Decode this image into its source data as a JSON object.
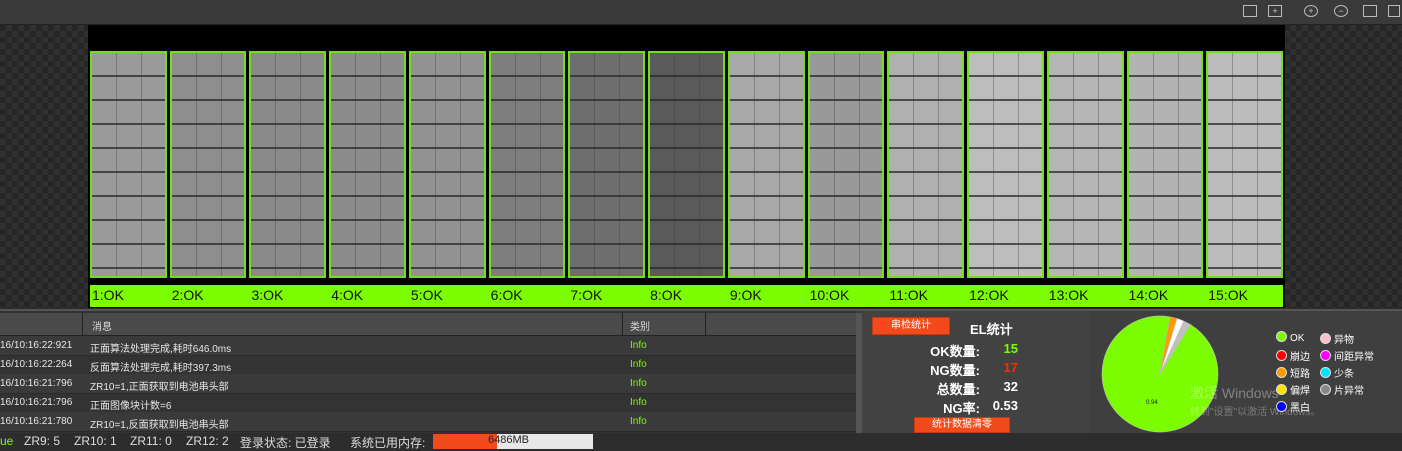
{
  "toolbar": {
    "icons": [
      "fit-icon",
      "crosshair-icon",
      "zoom-in-icon",
      "zoom-out-icon",
      "fullscreen-icon",
      "restore-icon"
    ]
  },
  "cells": [
    "1:OK",
    "2:OK",
    "3:OK",
    "4:OK",
    "5:OK",
    "6:OK",
    "7:OK",
    "8:OK",
    "9:OK",
    "10:OK",
    "11:OK",
    "12:OK",
    "13:OK",
    "14:OK",
    "15:OK"
  ],
  "log": {
    "headers": {
      "time": "",
      "message": "消息",
      "level": "类别"
    },
    "rows": [
      {
        "time": "16/10:16:22:921",
        "message": "正面算法处理完成,耗时646.0ms",
        "level": "Info"
      },
      {
        "time": "16/10:16:22:264",
        "message": "反面算法处理完成,耗时397.3ms",
        "level": "Info"
      },
      {
        "time": "16/10:16:21:796",
        "message": "ZR10=1,正面获取到电池串头部",
        "level": "Info"
      },
      {
        "time": "16/10:16:21:796",
        "message": "正面图像块计数=6",
        "level": "Info"
      },
      {
        "time": "16/10:16:21:780",
        "message": "ZR10=1,反面获取到电池串头部",
        "level": "Info"
      }
    ]
  },
  "stats": {
    "title": "EL统计",
    "top_button": "串检统计",
    "clear_button": "统计数据清零",
    "ok_label": "OK数量:",
    "ok_value": "15",
    "ng_label": "NG数量:",
    "ng_value": "17",
    "total_label": "总数量:",
    "total_value": "32",
    "rate_label": "NG率:",
    "rate_value": "0.53",
    "colors": {
      "ok": "#7cfc00",
      "ng": "#ff2a00"
    }
  },
  "pie": {
    "center_label": "0.94",
    "slices": [
      {
        "name": "OK",
        "fraction": 0.94,
        "color": "#7cfc00"
      },
      {
        "name": "短路",
        "fraction": 0.02,
        "color": "#ff9900"
      },
      {
        "name": "少条",
        "fraction": 0.02,
        "color": "#ffffff"
      },
      {
        "name": "片异常",
        "fraction": 0.02,
        "color": "#c0c0c0"
      }
    ]
  },
  "legend": [
    {
      "label": "OK",
      "color": "#7cfc00"
    },
    {
      "label": "异物",
      "color": "#ffc0cb"
    },
    {
      "label": "崩边",
      "color": "#ff0000"
    },
    {
      "label": "间距异常",
      "color": "#ff00ff"
    },
    {
      "label": "短路",
      "color": "#ff9900"
    },
    {
      "label": "少条",
      "color": "#00e5ff"
    },
    {
      "label": "偏焊",
      "color": "#ffe400"
    },
    {
      "label": "片异常",
      "color": "#888888"
    },
    {
      "label": "黑白",
      "color": "#0000ff"
    }
  ],
  "watermark": {
    "line1": "激活 Windows",
    "line2": "转到\"设置\"以激活 Windows。"
  },
  "statusbar": {
    "prefix": "ue",
    "zr9": "ZR9: 5",
    "zr10": "ZR10: 1",
    "zr11": "ZR11: 0",
    "zr12": "ZR12: 2",
    "login": "登录状态: 已登录",
    "mem_label": "系统已用内存:",
    "mem_value": "6486MB",
    "mem_fraction": 0.4
  }
}
